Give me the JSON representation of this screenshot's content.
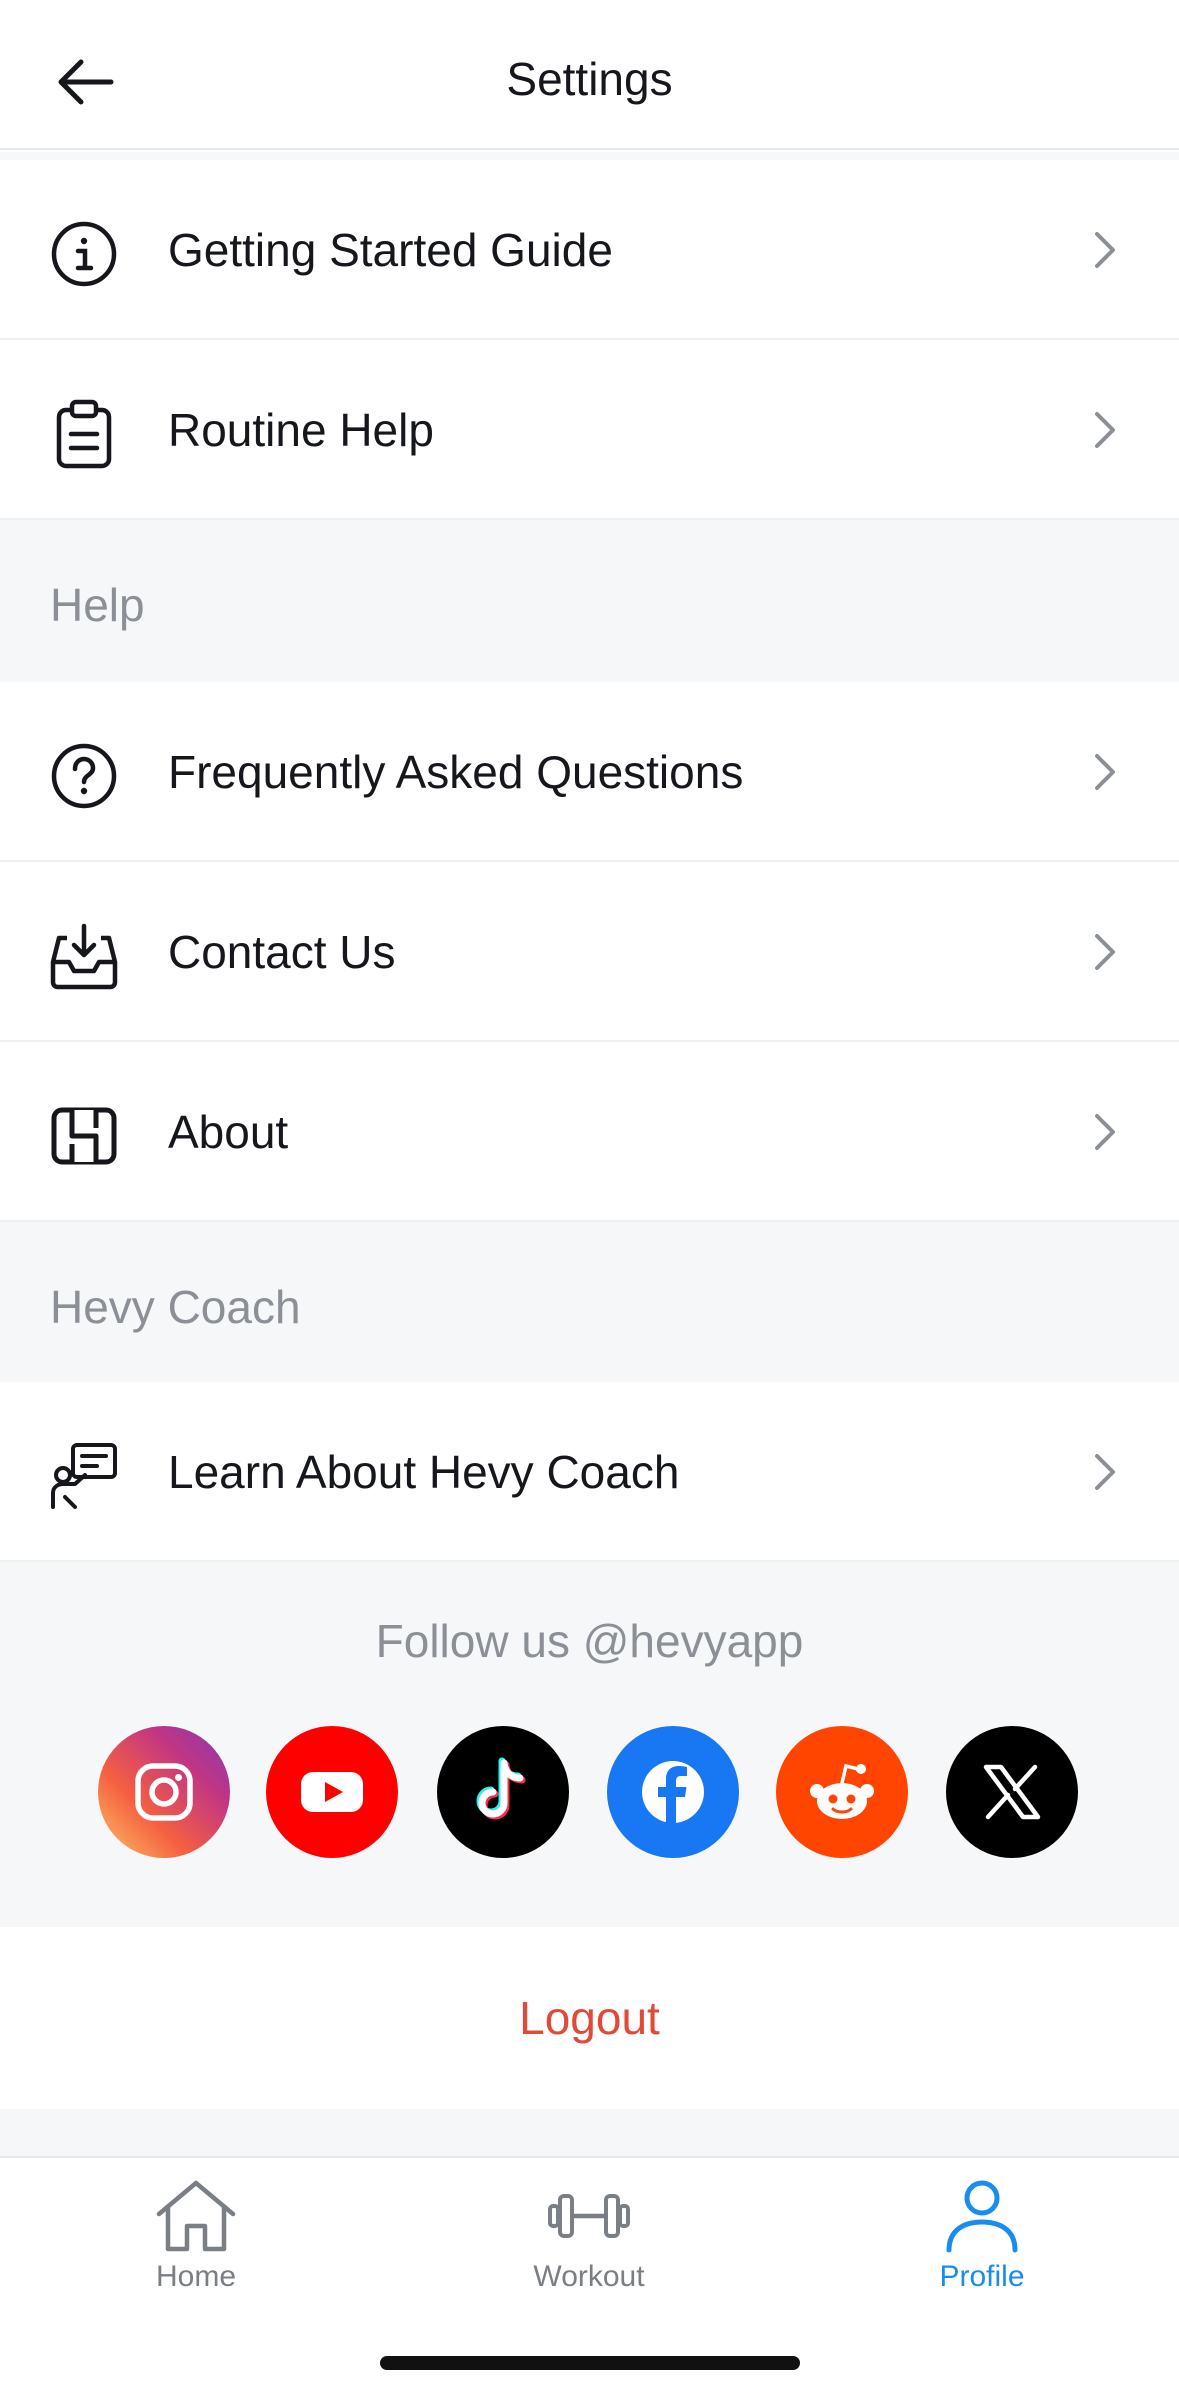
{
  "header": {
    "title": "Settings"
  },
  "rows_top": [
    {
      "label": "Getting Started Guide",
      "icon": "info-icon"
    },
    {
      "label": "Routine Help",
      "icon": "clipboard-icon"
    }
  ],
  "sections": {
    "help": {
      "title": "Help",
      "rows": [
        {
          "label": "Frequently Asked Questions",
          "icon": "question-icon"
        },
        {
          "label": "Contact Us",
          "icon": "inbox-download-icon"
        },
        {
          "label": "About",
          "icon": "hevy-logo-icon"
        }
      ]
    },
    "coach": {
      "title": "Hevy Coach",
      "rows": [
        {
          "label": "Learn About Hevy Coach",
          "icon": "coach-icon"
        }
      ]
    }
  },
  "follow": {
    "text": "Follow us @hevyapp",
    "socials": [
      {
        "name": "instagram",
        "icon": "instagram-icon"
      },
      {
        "name": "youtube",
        "icon": "youtube-icon",
        "color": "#ff0000"
      },
      {
        "name": "tiktok",
        "icon": "tiktok-icon",
        "color": "#000000"
      },
      {
        "name": "facebook",
        "icon": "facebook-icon",
        "color": "#1877f2"
      },
      {
        "name": "reddit",
        "icon": "reddit-icon",
        "color": "#ff4500"
      },
      {
        "name": "x",
        "icon": "x-icon",
        "color": "#000000"
      }
    ]
  },
  "logout": {
    "label": "Logout",
    "color": "#e04a38"
  },
  "tabbar": {
    "tabs": [
      {
        "label": "Home",
        "icon": "home-icon",
        "active": false
      },
      {
        "label": "Workout",
        "icon": "dumbbell-icon",
        "active": false
      },
      {
        "label": "Profile",
        "icon": "person-icon",
        "active": true
      }
    ],
    "active_color": "#1a8cef",
    "inactive_color": "#7a7e85"
  }
}
